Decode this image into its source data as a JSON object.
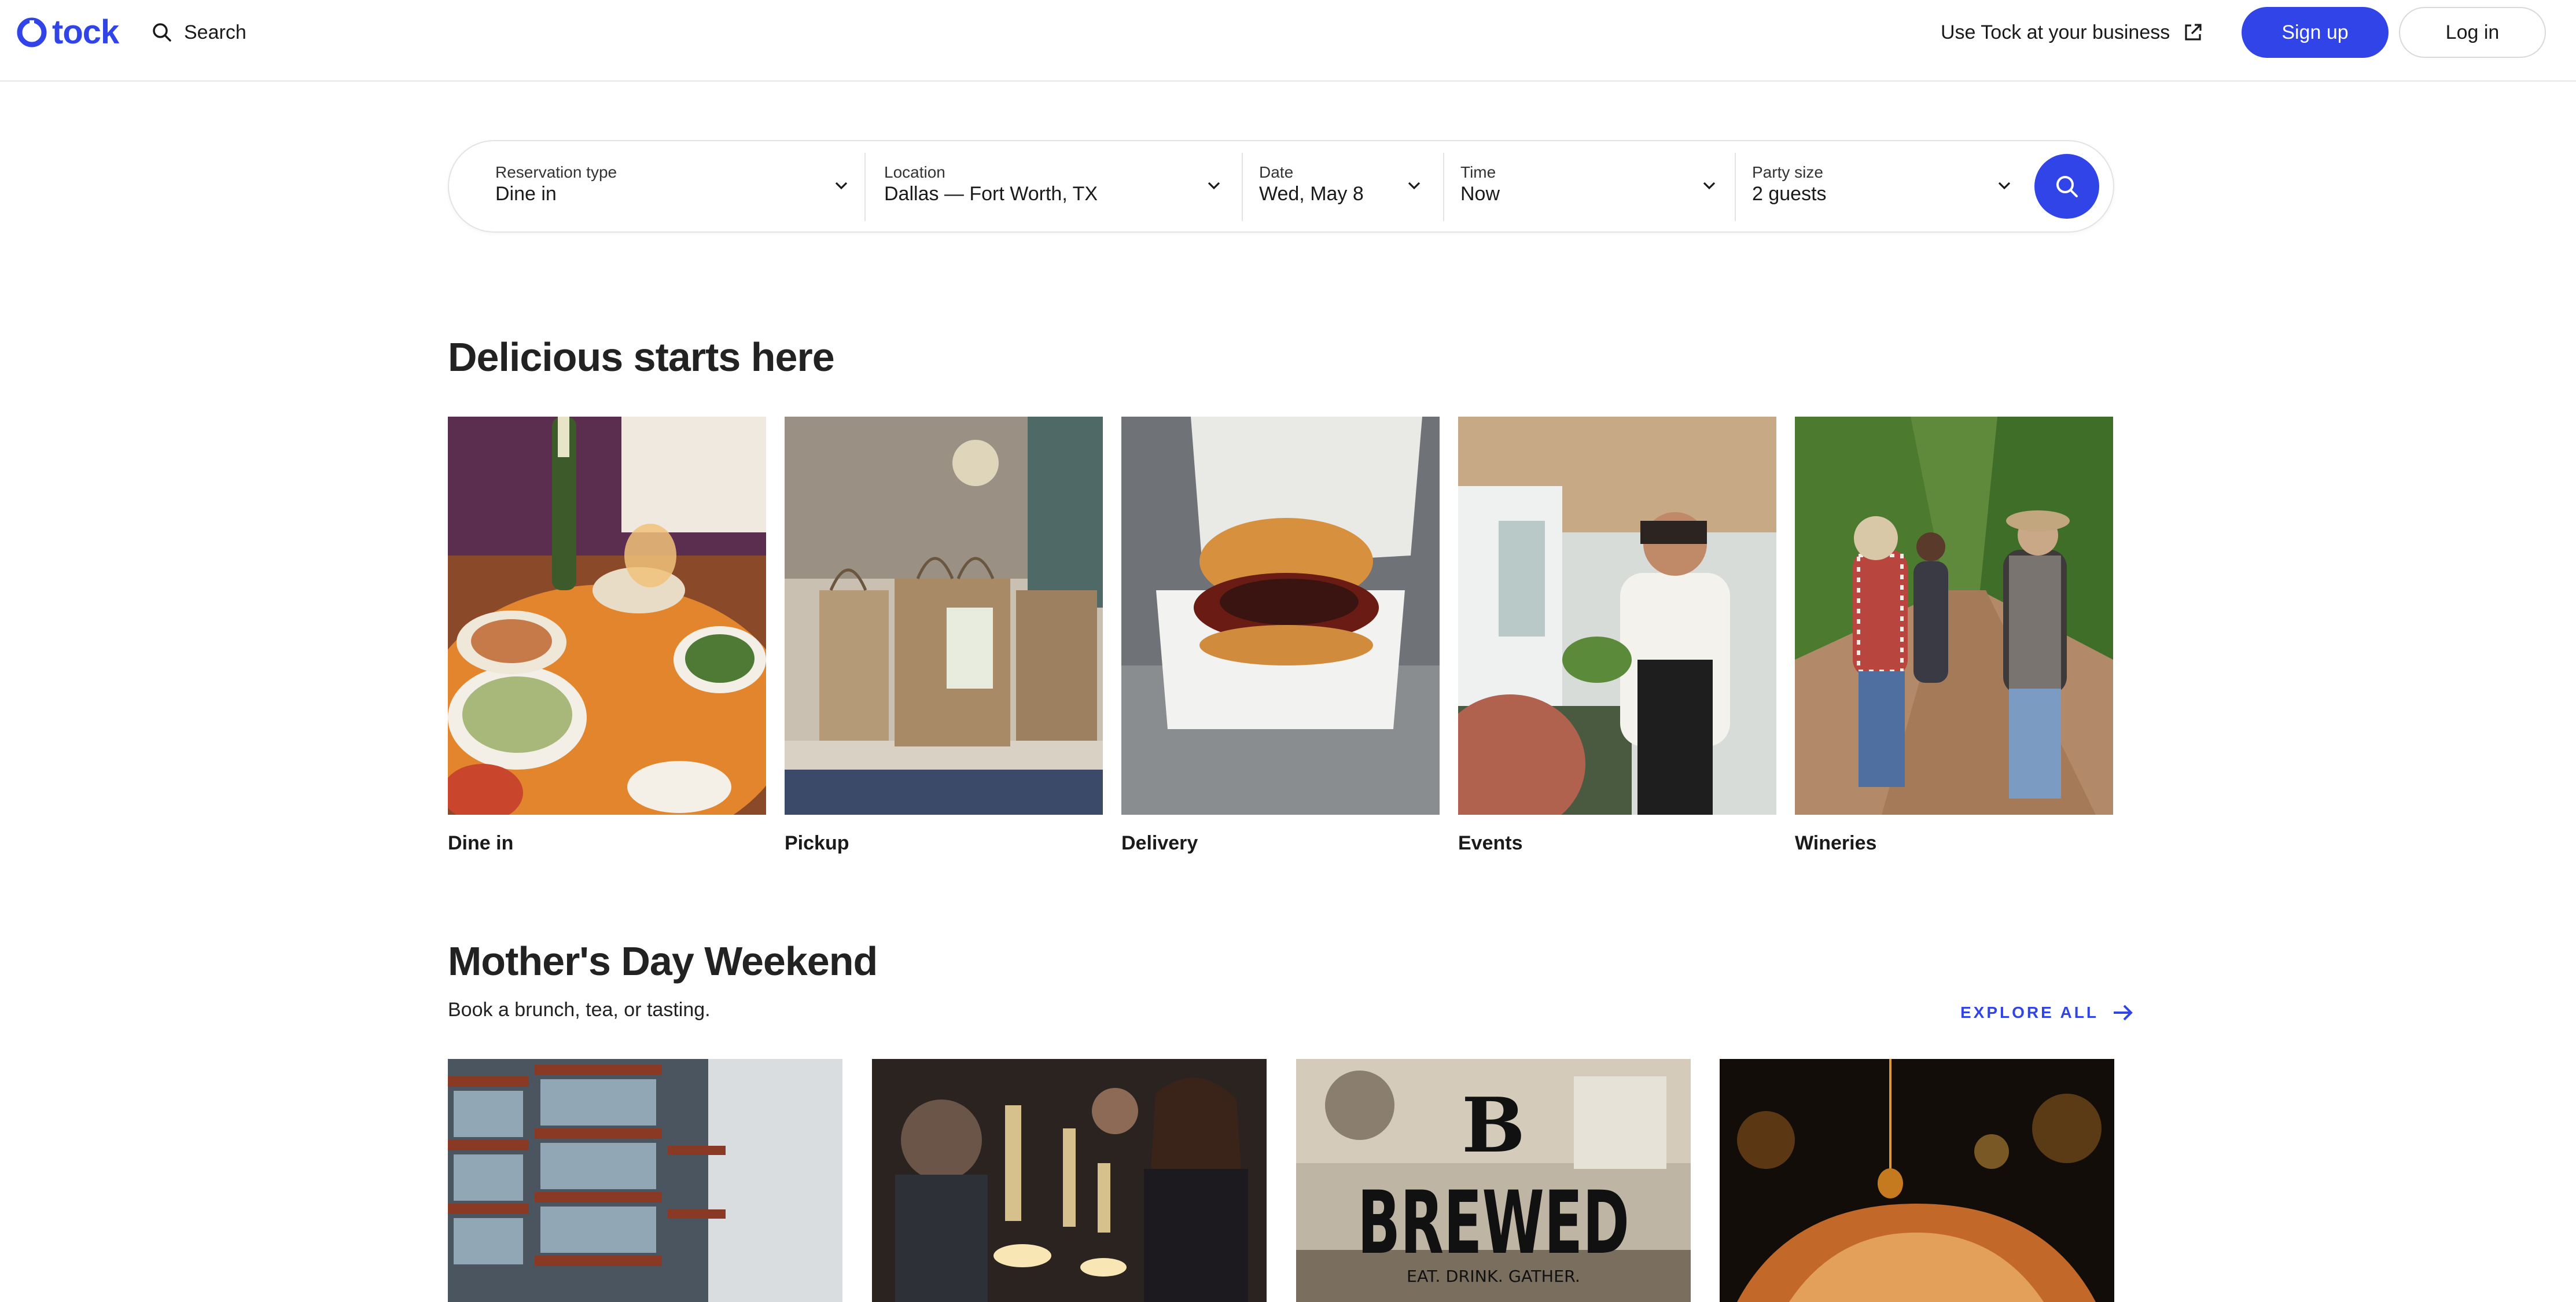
{
  "nav": {
    "logo_text": "tock",
    "search_label": "Search",
    "business_link": "Use Tock at your business",
    "signup": "Sign up",
    "login": "Log in"
  },
  "search": {
    "reservation_type": {
      "label": "Reservation type",
      "value": "Dine in"
    },
    "location": {
      "label": "Location",
      "value": "Dallas — Fort Worth, TX"
    },
    "date": {
      "label": "Date",
      "value": "Wed, May 8"
    },
    "time": {
      "label": "Time",
      "value": "Now"
    },
    "party_size": {
      "label": "Party size",
      "value": "2 guests"
    }
  },
  "section1": {
    "title": "Delicious starts here",
    "categories": [
      {
        "label": "Dine in"
      },
      {
        "label": "Pickup"
      },
      {
        "label": "Delivery"
      },
      {
        "label": "Events"
      },
      {
        "label": "Wineries"
      }
    ]
  },
  "section2": {
    "title": "Mother's Day Weekend",
    "subtitle": "Book a brunch, tea, or tasting.",
    "explore_all": "EXPLORE ALL",
    "card3_logo": "BREWED",
    "card3_tagline": "EAT. DRINK. GATHER."
  },
  "colors": {
    "accent": "#3044e7"
  }
}
